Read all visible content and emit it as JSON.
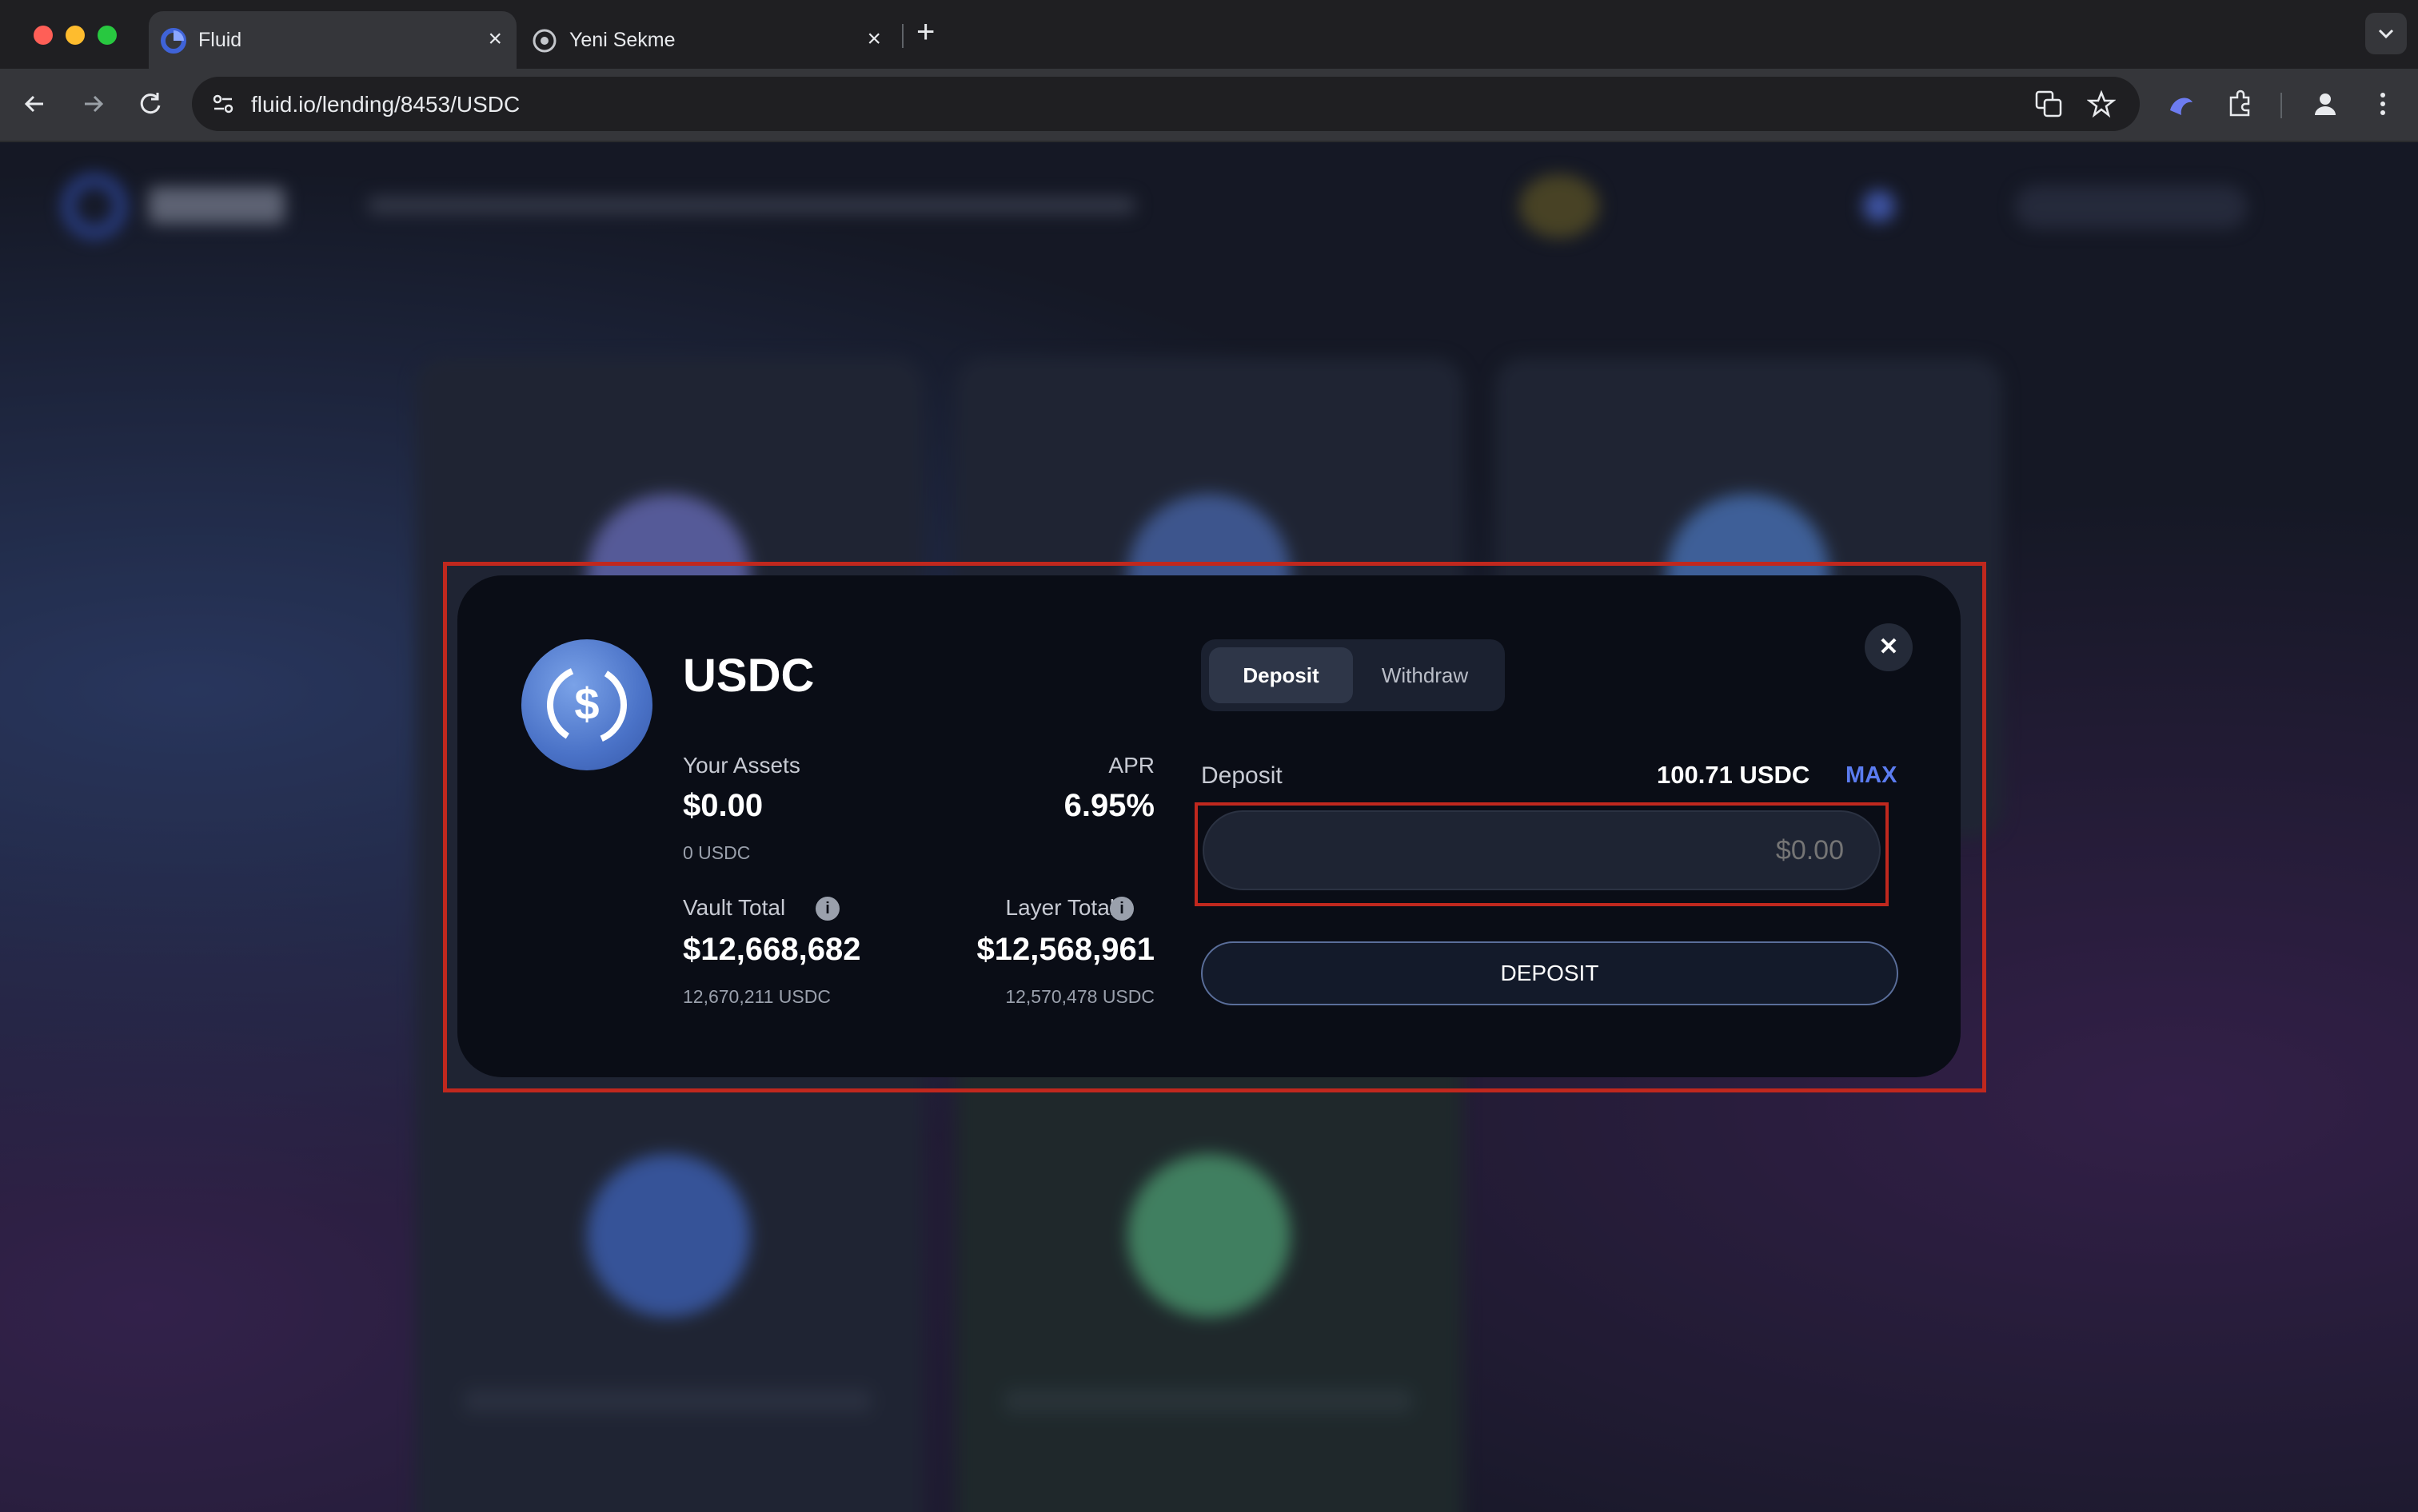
{
  "browser": {
    "tabs": [
      {
        "title": "Fluid",
        "active": true
      },
      {
        "title": "Yeni Sekme",
        "active": false
      }
    ],
    "url": "fluid.io/lending/8453/USDC"
  },
  "modal": {
    "asset": "USDC",
    "your_assets_label": "Your Assets",
    "your_assets_value": "$0.00",
    "your_assets_sub": "0 USDC",
    "apr_label": "APR",
    "apr_value": "6.95%",
    "vault_total_label": "Vault Total",
    "vault_total_value": "$12,668,682",
    "vault_total_sub": "12,670,211 USDC",
    "layer_total_label": "Layer Total",
    "layer_total_value": "$12,568,961",
    "layer_total_sub": "12,570,478 USDC",
    "tabs": {
      "deposit": "Deposit",
      "withdraw": "Withdraw"
    },
    "deposit_label": "Deposit",
    "balance": "100.71 USDC",
    "max_label": "MAX",
    "amount_placeholder": "$0.00",
    "deposit_button": "DEPOSIT",
    "close_glyph": "✕"
  },
  "colors": {
    "accent": "#5b7cf0",
    "highlight": "#c0281e",
    "modal_bg": "#0a0d16"
  }
}
